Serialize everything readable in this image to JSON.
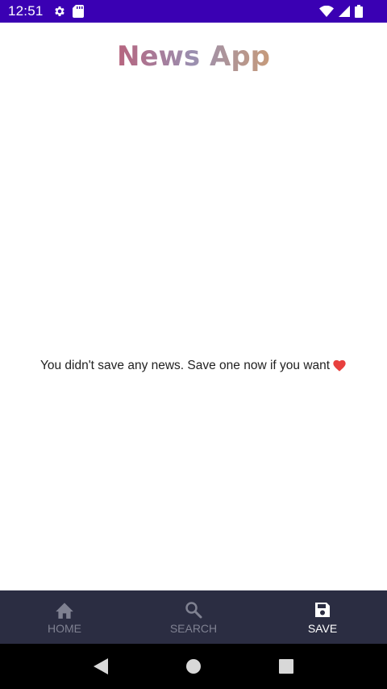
{
  "status_bar": {
    "time": "12:51",
    "left_icons": [
      "settings-icon",
      "sd-card-icon"
    ],
    "right_icons": [
      "wifi-icon",
      "signal-icon",
      "battery-icon"
    ],
    "background": "#3a00b3"
  },
  "app": {
    "title": "News App"
  },
  "main": {
    "empty_message": "You didn't save any news. Save one now if you want",
    "empty_icon": "heart-icon"
  },
  "bottom_nav": {
    "background": "#2b2d42",
    "items": [
      {
        "label": "HOME",
        "icon": "home-icon",
        "active": false
      },
      {
        "label": "SEARCH",
        "icon": "search-icon",
        "active": false
      },
      {
        "label": "SAVE",
        "icon": "save-icon",
        "active": true
      }
    ]
  },
  "system_nav": {
    "buttons": [
      "back-icon",
      "home-circle-icon",
      "recents-icon"
    ]
  }
}
